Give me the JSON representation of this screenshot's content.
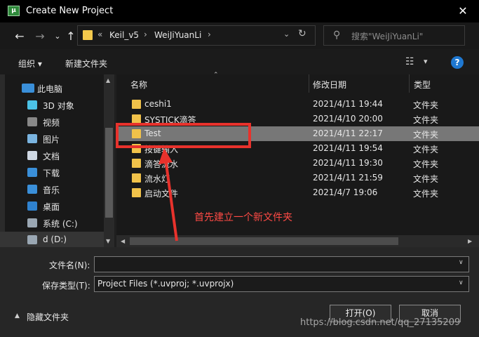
{
  "window": {
    "title": "Create New Project",
    "app_icon_text": "μ",
    "close_glyph": "✕"
  },
  "nav": {
    "back_glyph": "←",
    "forward_glyph": "→",
    "dropdown_glyph": "⌄",
    "up_glyph": "↑",
    "breadcrumb_prefix": "«",
    "breadcrumbs": [
      "Keil_v5",
      "WeiJiYuanLi"
    ],
    "separator": "›",
    "history_glyph": "⌄",
    "refresh_glyph": "↻",
    "search_placeholder": "搜索\"WeiJiYuanLi\""
  },
  "toolbar": {
    "organize_label": "组织 ▾",
    "new_folder_label": "新建文件夹",
    "view_glyph": "☷",
    "view_caret": "▾",
    "help_glyph": "?"
  },
  "sidebar": {
    "items": [
      {
        "label": "此电脑",
        "icon": "computer-icon",
        "color": "#3a8fd9"
      },
      {
        "label": "3D 对象",
        "icon": "cube-icon",
        "color": "#4cc2e6"
      },
      {
        "label": "视频",
        "icon": "video-icon",
        "color": "#888888"
      },
      {
        "label": "图片",
        "icon": "picture-icon",
        "color": "#7ab4e0"
      },
      {
        "label": "文档",
        "icon": "document-icon",
        "color": "#cfd8e3"
      },
      {
        "label": "下载",
        "icon": "download-icon",
        "color": "#3a8fd9"
      },
      {
        "label": "音乐",
        "icon": "music-icon",
        "color": "#3a8fd9"
      },
      {
        "label": "桌面",
        "icon": "desktop-icon",
        "color": "#2f82cf"
      },
      {
        "label": "系统 (C:)",
        "icon": "drive-icon",
        "color": "#9aa7b3"
      },
      {
        "label": "d (D:)",
        "icon": "drive-icon",
        "color": "#9aa7b3"
      }
    ]
  },
  "filelist": {
    "columns": {
      "name": "名称",
      "date": "修改日期",
      "type": "类型"
    },
    "rows": [
      {
        "name": "ceshi1",
        "date": "2021/4/11 19:44",
        "type": "文件夹"
      },
      {
        "name": "SYSTICK滴答",
        "date": "2021/4/10 20:00",
        "type": "文件夹"
      },
      {
        "name": "Test",
        "date": "2021/4/11 22:17",
        "type": "文件夹"
      },
      {
        "name": "按键输入",
        "date": "2021/4/11 19:54",
        "type": "文件夹"
      },
      {
        "name": "滴答流水",
        "date": "2021/4/11 19:30",
        "type": "文件夹"
      },
      {
        "name": "流水灯",
        "date": "2021/4/11 21:59",
        "type": "文件夹"
      },
      {
        "name": "启动文件",
        "date": "2021/4/7 19:06",
        "type": "文件夹"
      }
    ]
  },
  "annotation": {
    "text": "首先建立一个新文件夹",
    "color": "#e8322c"
  },
  "bottom": {
    "filename_label": "文件名(N):",
    "filename_value": "",
    "filetype_label": "保存类型(T):",
    "filetype_value": "Project Files (*.uvproj; *.uvprojx)",
    "hide_folders_label": "隐藏文件夹",
    "hide_caret": "▲",
    "open_button": "打开(O)",
    "cancel_button": "取消",
    "caret": "∨"
  },
  "watermark": "https://blog.csdn.net/qq_27135209"
}
